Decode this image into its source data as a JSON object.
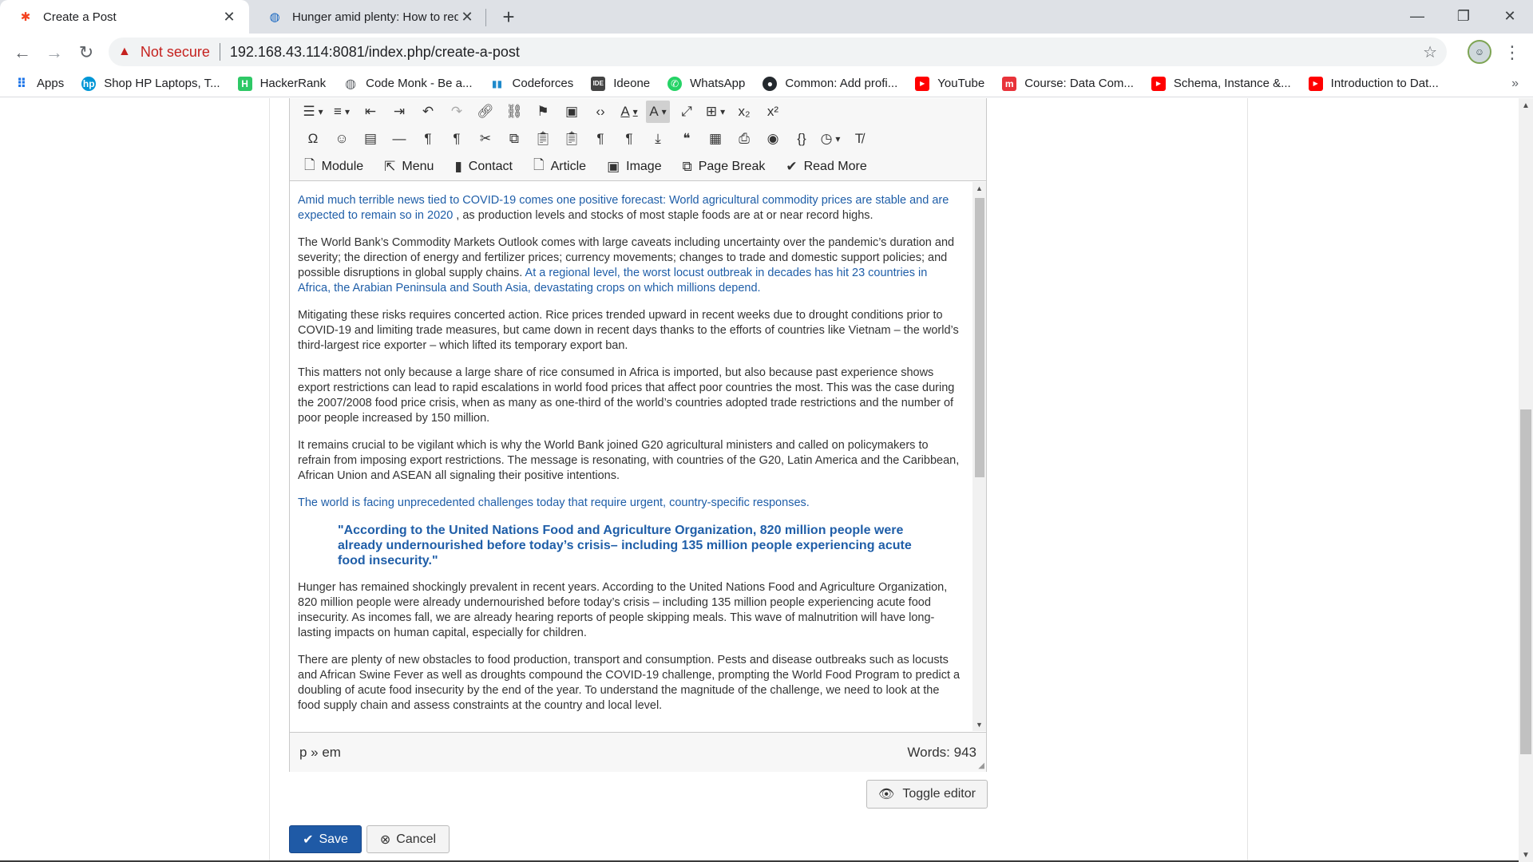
{
  "browser": {
    "tabs": [
      {
        "title": "Create a Post",
        "icon": "joomla-icon",
        "active": true
      },
      {
        "title": "Hunger amid plenty: How to redu",
        "icon": "globe-icon",
        "active": false
      }
    ],
    "security_label": "Not secure",
    "url": "192.168.43.114:8081/index.php/create-a-post",
    "bookmarks": [
      {
        "label": "Apps",
        "icon": "apps-grid-icon"
      },
      {
        "label": "Shop HP Laptops, T...",
        "icon": "hp-icon"
      },
      {
        "label": "HackerRank",
        "icon": "hackerrank-icon"
      },
      {
        "label": "Code Monk - Be a...",
        "icon": "globe-icon"
      },
      {
        "label": "Codeforces",
        "icon": "codeforces-icon"
      },
      {
        "label": "Ideone",
        "icon": "ideone-icon"
      },
      {
        "label": "WhatsApp",
        "icon": "whatsapp-icon"
      },
      {
        "label": "Common: Add profi...",
        "icon": "github-icon"
      },
      {
        "label": "YouTube",
        "icon": "youtube-icon"
      },
      {
        "label": "Course: Data Com...",
        "icon": "moodle-icon"
      },
      {
        "label": "Schema, Instance &...",
        "icon": "youtube-icon"
      },
      {
        "label": "Introduction to Dat...",
        "icon": "youtube-icon"
      }
    ]
  },
  "editor": {
    "buttons_row3": [
      {
        "label": "Module",
        "icon": "add-file-icon"
      },
      {
        "label": "Menu",
        "icon": "share-icon"
      },
      {
        "label": "Contact",
        "icon": "address-book-icon"
      },
      {
        "label": "Article",
        "icon": "add-file-icon"
      },
      {
        "label": "Image",
        "icon": "image-icon"
      },
      {
        "label": "Page Break",
        "icon": "copy-icon"
      },
      {
        "label": "Read More",
        "icon": "chevron-down-icon"
      }
    ],
    "paragraphs": {
      "p1_link": "Amid much terrible news tied to COVID-19 comes one positive forecast: World agricultural commodity prices are stable and are expected to remain so in 2020",
      "p1_rest": " , as production levels and stocks of most staple foods are at or near record highs.",
      "p2_text": "The World Bank’s Commodity Markets Outlook comes with large caveats including uncertainty over the pandemic’s duration and severity; the direction of energy and fertilizer prices; currency movements; changes to trade and domestic support policies; and possible disruptions in global supply chains. ",
      "p2_link": "At a regional level, the worst locust outbreak in decades has hit 23 countries in Africa, the Arabian Peninsula and South Asia, devastating crops on which millions depend.",
      "p3": "Mitigating these risks requires concerted action. Rice prices trended upward in recent weeks due to drought conditions prior to COVID-19 and limiting trade measures, but came down in recent days thanks to the efforts of countries like Vietnam – the world’s third-largest rice exporter – which lifted its temporary export ban.",
      "p4": "This matters not only because a large share of rice consumed in Africa is imported, but also because past experience shows export restrictions can lead to rapid escalations in world food prices that affect poor countries the most. This was the case during the 2007/2008 food price crisis, when as many as one-third of the world’s countries adopted trade restrictions and the number of poor people increased by 150 million.",
      "p5": "It remains crucial to be vigilant which is why the World Bank joined G20 agricultural ministers and called on policymakers to refrain from imposing export restrictions. The message is resonating, with countries of the G20, Latin America and the Caribbean, African Union and ASEAN all signaling their positive intentions.",
      "p6_link": "The world is facing unprecedented challenges today that require urgent, country-specific responses.",
      "quote": "\"According to the United Nations Food and Agriculture Organization, 820 million people were already undernourished before today’s crisis– including 135 million people experiencing acute food insecurity.\"",
      "p7": "Hunger has remained shockingly prevalent in recent years. According to the United Nations Food and Agriculture Organization, 820 million people were already undernourished before today’s crisis – including 135 million people experiencing acute food insecurity. As incomes fall, we are already hearing reports of people skipping meals. This wave of malnutrition will have long-lasting impacts on human capital, especially for children.",
      "p8": "There are plenty of new obstacles to food production, transport and consumption. Pests and disease outbreaks such as locusts and African Swine Fever as well as droughts compound the COVID-19 challenge, prompting the World Food Program to predict a doubling of acute food insecurity by the end of the year. To understand the magnitude of the challenge, we need to look at the food supply chain and assess constraints at the country and local level."
    },
    "path": "p » em",
    "word_count": "Words: 943",
    "link_color": "#1f5ea8"
  },
  "actions": {
    "toggle_editor": "Toggle editor",
    "save": "Save",
    "cancel": "Cancel",
    "save_color": "#1f5aa6"
  }
}
